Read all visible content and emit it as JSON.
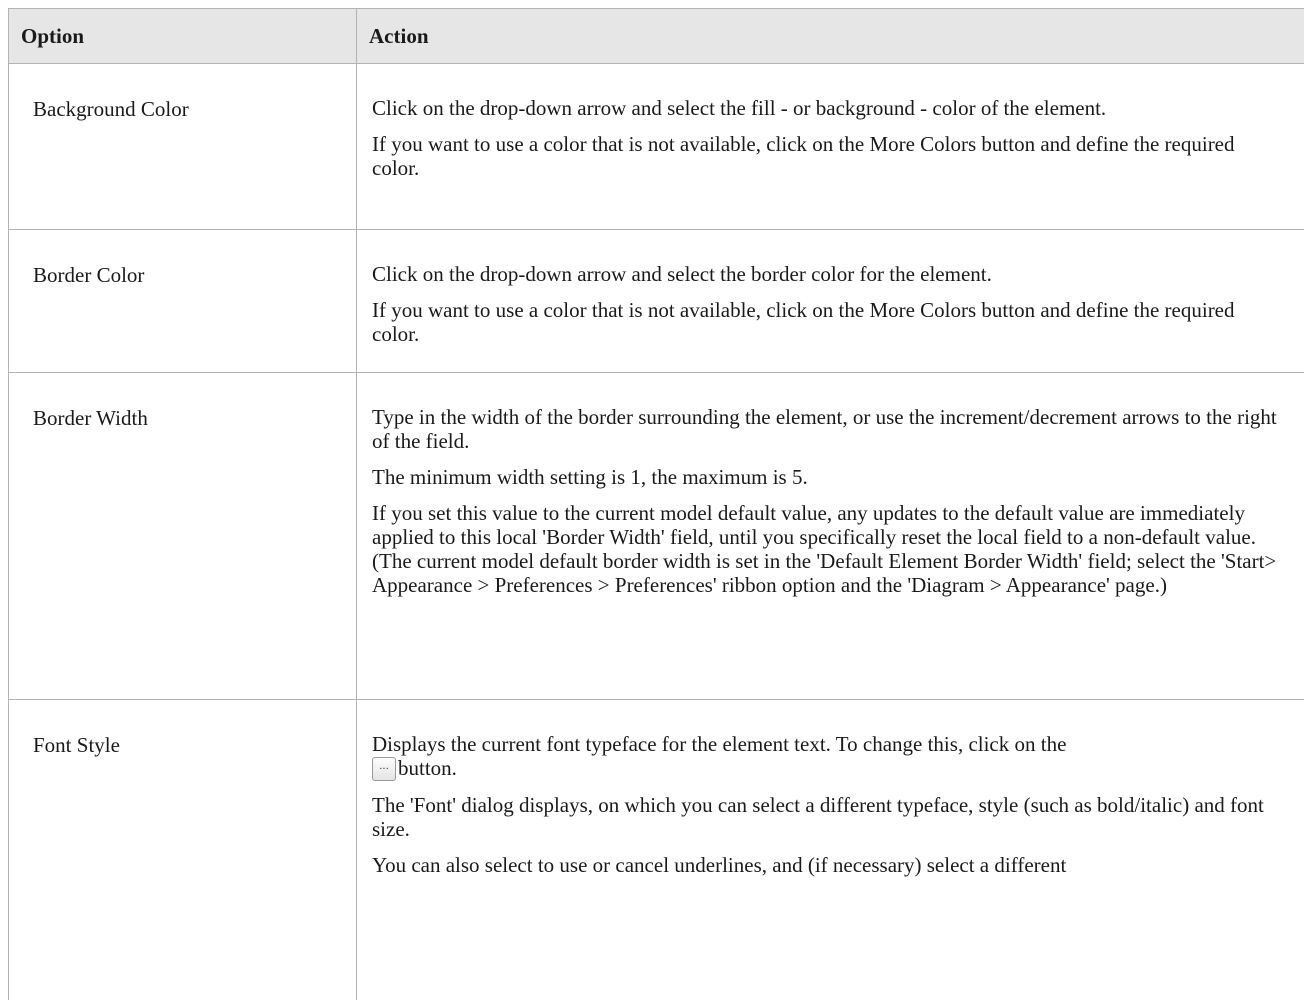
{
  "table": {
    "headers": [
      "Option",
      "Action"
    ],
    "rows": [
      {
        "option": "Background Color",
        "action": [
          "Click on the drop-down arrow and select the fill - or background - color of the element.",
          "If you want to use a color that is not available, click on the More Colors button and define the required color."
        ]
      },
      {
        "option": "Border Color",
        "action": [
          "Click on the drop-down arrow and select the border color for the element.",
          "If you want to use a color that is not available, click on the More Colors button and define the required color."
        ]
      },
      {
        "option": "Border Width",
        "action": [
          "Type in the width of the border surrounding the element, or use the increment/decrement arrows to the right of the field.",
          "The minimum width setting is 1, the maximum is 5.",
          "If you set this value to the current model default value, any updates to the default value are immediately applied to this local 'Border Width' field, until you specifically reset the local field to a non-default value. (The current model default border width is set in the 'Default Element Border Width' field; select the 'Start> Appearance > Preferences > Preferences' ribbon option and the 'Diagram > Appearance' page.)"
        ]
      },
      {
        "option": "Font Style",
        "action": [
          "Displays the current font typeface for the element text. To change this, click on the",
          "button.",
          "The 'Font' dialog displays, on which you can select a different typeface, style (such as bold/italic) and font size.",
          "You can also select to use or cancel underlines, and (if necessary) select a different"
        ],
        "inline_button_label": "..."
      }
    ]
  }
}
